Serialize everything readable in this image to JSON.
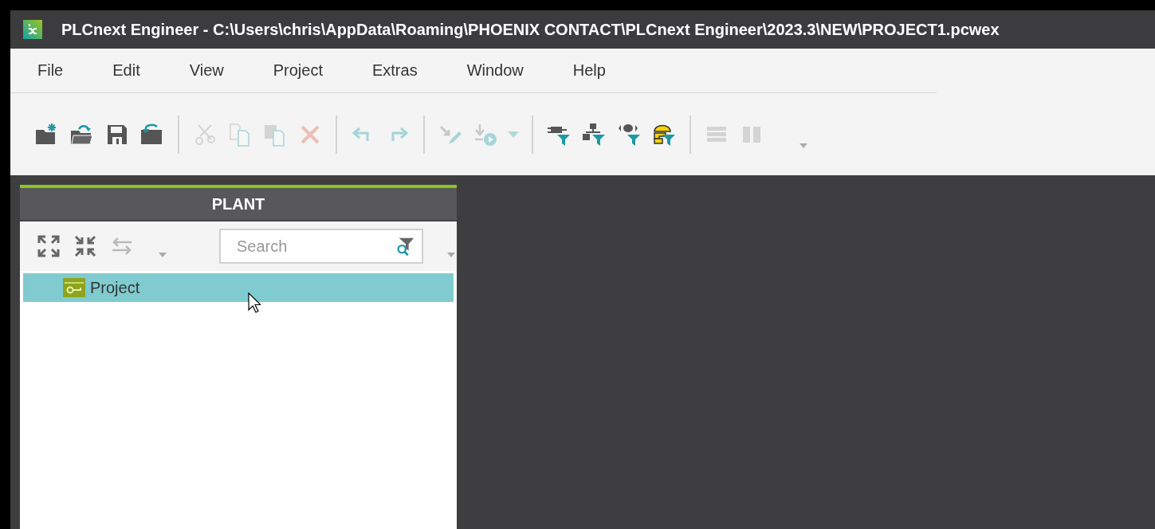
{
  "window": {
    "title": "PLCnext Engineer - C:\\Users\\chris\\AppData\\Roaming\\PHOENIX CONTACT\\PLCnext Engineer\\2023.3\\NEW\\PROJECT1.pcwex"
  },
  "menu": [
    "File",
    "Edit",
    "View",
    "Project",
    "Extras",
    "Window",
    "Help"
  ],
  "toolbar": [
    [
      {
        "kind": "new-folder",
        "disabled": false
      },
      {
        "kind": "open-folder",
        "disabled": false
      },
      {
        "kind": "save",
        "disabled": false
      },
      {
        "kind": "import-folder",
        "disabled": false
      }
    ],
    [
      {
        "kind": "cut",
        "disabled": true
      },
      {
        "kind": "copy",
        "disabled": true
      },
      {
        "kind": "paste",
        "disabled": true
      },
      {
        "kind": "delete",
        "disabled": true
      }
    ],
    [
      {
        "kind": "undo",
        "disabled": true
      },
      {
        "kind": "redo",
        "disabled": true
      }
    ],
    [
      {
        "kind": "write",
        "disabled": true
      },
      {
        "kind": "download-run",
        "disabled": true
      }
    ],
    [
      {
        "kind": "plug-filter",
        "disabled": false
      },
      {
        "kind": "network-filter",
        "disabled": false
      },
      {
        "kind": "device-filter",
        "disabled": false
      },
      {
        "kind": "safety-filter",
        "disabled": false
      }
    ],
    [
      {
        "kind": "rows",
        "disabled": true
      },
      {
        "kind": "columns",
        "disabled": true
      }
    ]
  ],
  "panel": {
    "title": "PLANT",
    "tools": [
      {
        "kind": "expand",
        "disabled": false
      },
      {
        "kind": "collapse",
        "disabled": false
      },
      {
        "kind": "swap",
        "disabled": true
      }
    ],
    "search": {
      "placeholder": "Search"
    },
    "tree": [
      {
        "label": "Project",
        "selected": true
      }
    ]
  }
}
